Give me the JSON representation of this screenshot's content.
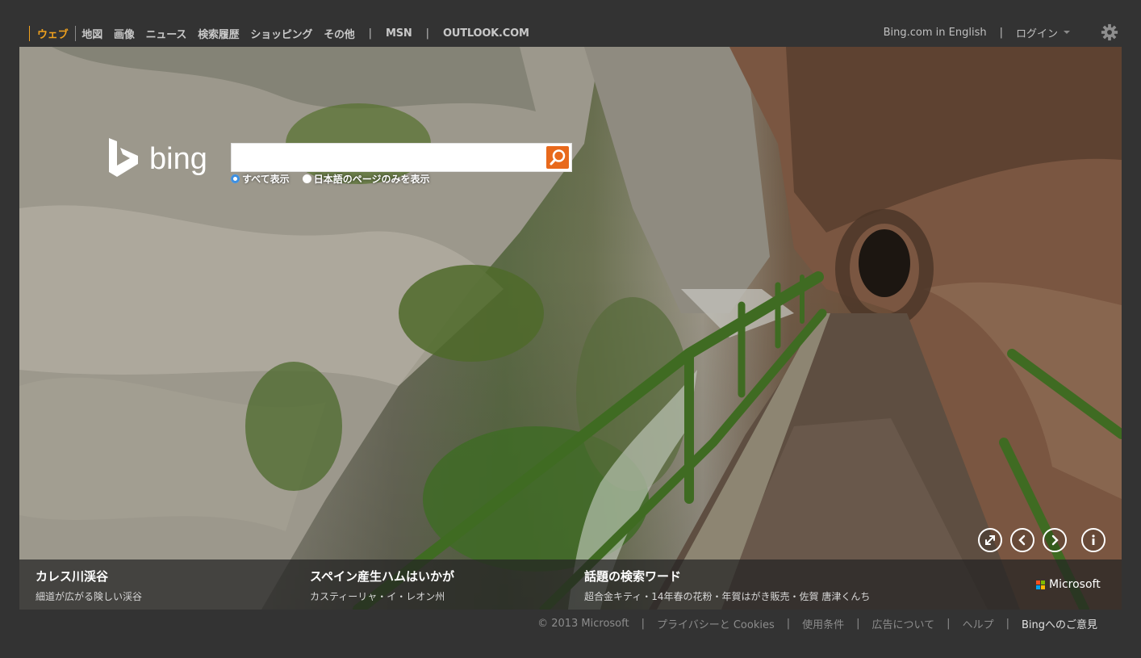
{
  "nav": {
    "left_items": [
      "ウェブ",
      "地図",
      "画像",
      "ニュース",
      "検索履歴",
      "ショッピング",
      "その他"
    ],
    "active": "ウェブ",
    "extra_items": [
      "MSN",
      "OUTLOOK.COM"
    ],
    "separator": "|"
  },
  "header_right": {
    "english_link": "Bing.com in English",
    "login": "ログイン",
    "settings_icon": "gear-icon"
  },
  "logo": {
    "text": "bing"
  },
  "search": {
    "value": "",
    "placeholder": "",
    "button_icon": "search-icon",
    "accent_color": "#e8691c"
  },
  "scope": {
    "options": [
      "すべて表示",
      "日本語のページのみを表示"
    ],
    "selected": "すべて表示"
  },
  "hero_controls": [
    "fullscreen-icon",
    "previous-icon",
    "next-icon",
    "info-icon"
  ],
  "stories": [
    {
      "title": "カレス川渓谷",
      "subtitle": "細道が広がる険しい渓谷"
    },
    {
      "title": "スペイン産生ハムはいかが",
      "subtitle": "カスティーリャ・イ・レオン州"
    },
    {
      "title": "話題の検索ワード",
      "subtitle": "超合金キティ・14年春の花粉・年賀はがき販売・佐賀 唐津くんち"
    }
  ],
  "microsoft_brand": "Microsoft",
  "footer": {
    "copyright": "© 2013 Microsoft",
    "links": [
      "プライバシーと Cookies",
      "使用条件",
      "広告について",
      "ヘルプ"
    ],
    "feedback": "Bingへのご意見"
  },
  "colors": {
    "page_bg": "#333333",
    "active_nav": "#f0a11e",
    "rail_green": "#3f6b22"
  }
}
